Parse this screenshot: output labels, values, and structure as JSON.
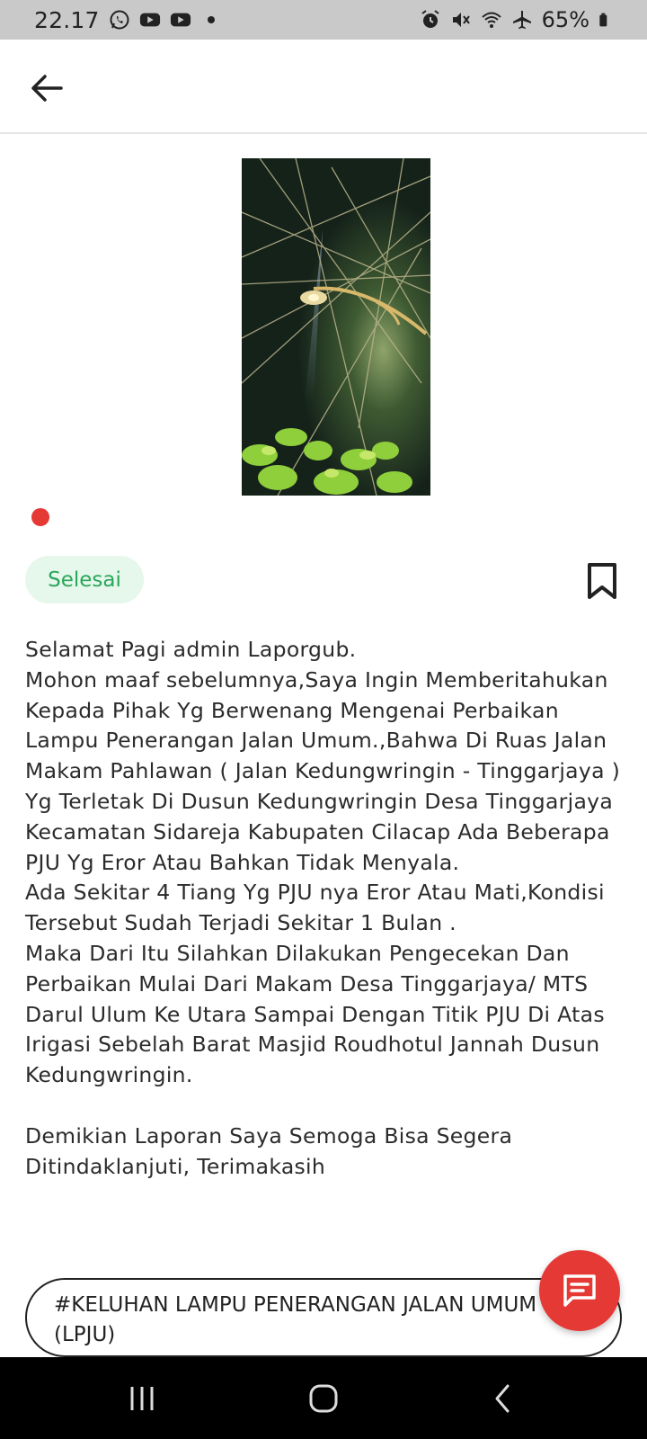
{
  "status_bar": {
    "time": "22.17",
    "battery": "65%",
    "left_icons": [
      "whatsapp-icon",
      "youtube-icon",
      "youtube-icon",
      "dot-icon"
    ],
    "right_icons": [
      "alarm-icon",
      "mute-icon",
      "wifi-icon",
      "airplane-icon",
      "battery-icon"
    ]
  },
  "app_bar": {
    "back_icon": "arrow-left-icon"
  },
  "report": {
    "status_label": "Selesai",
    "status_color": "#2aa65a",
    "paragraphs": [
      "Selamat Pagi admin  Laporgub.",
      "Mohon maaf sebelumnya,Saya Ingin Memberitahukan Kepada Pihak Yg Berwenang Mengenai Perbaikan Lampu Penerangan Jalan Umum.,Bahwa Di Ruas Jalan Makam Pahlawan ( Jalan Kedungwringin - Tinggarjaya ) Yg Terletak Di Dusun Kedungwringin Desa Tinggarjaya Kecamatan Sidareja Kabupaten Cilacap Ada Beberapa PJU Yg Eror Atau Bahkan Tidak Menyala.",
      "Ada Sekitar 4 Tiang Yg PJU nya Eror Atau Mati,Kondisi Tersebut  Sudah Terjadi Sekitar 1 Bulan .",
      "Maka Dari Itu Silahkan Dilakukan Pengecekan Dan Perbaikan Mulai Dari Makam Desa Tinggarjaya/ MTS Darul Ulum Ke Utara Sampai Dengan Titik PJU Di Atas Irigasi Sebelah Barat Masjid Roudhotul Jannah Dusun Kedungwringin.",
      "Demikian Laporan Saya Semoga Bisa Segera Ditindaklanjuti, Terimakasih"
    ],
    "category": "#KELUHAN LAMPU PENERANGAN JALAN UMUM (LPJU)"
  },
  "colors": {
    "accent_red": "#e53935",
    "pill_bg": "#e6f7ec"
  }
}
